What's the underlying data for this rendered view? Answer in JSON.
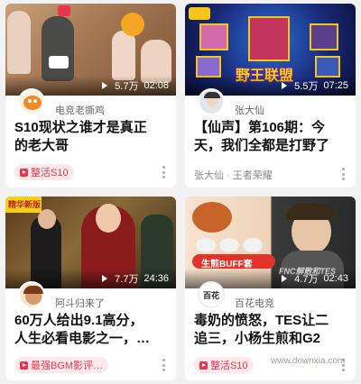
{
  "cards": [
    {
      "views": "5.7万",
      "duration": "02:08",
      "author": "电竞老撕鸡",
      "title_line1": "S10现状之谁才是真正",
      "title_line2": "的老大哥",
      "tag": "整活S10"
    },
    {
      "views": "5.5万",
      "duration": "07:25",
      "author": "张大仙",
      "title_line1": "【仙声】第106期：今",
      "title_line2": "天，我们全都是打野了",
      "sub": "张大仙 · 王者荣耀"
    },
    {
      "views": "7.7万",
      "duration": "24:36",
      "author": "阿斗归来了",
      "title_line1": "60万人给出9.1高分，",
      "title_line2": "人生必看电影之一，…",
      "tag": "最强BGM影评…"
    },
    {
      "views": "4.7万",
      "duration": "02:43",
      "author": "百花电竞",
      "title_line1": "毒奶的愤怒，TES让二",
      "title_line2": "追三，小杨生煎和G2",
      "tag": "整活S10"
    }
  ],
  "overlays": {
    "thumb2_text": "野王联盟",
    "thumb3_badge": "精华新版",
    "thumb4_banner": "生煎BUFF套",
    "thumb4_caption": "FNC解散和TES",
    "thumb4_logo": "百花",
    "watermark": "www.downxia.com"
  },
  "colors": {
    "accent": "#e8364e",
    "tag_bg": "#fde8eb"
  }
}
